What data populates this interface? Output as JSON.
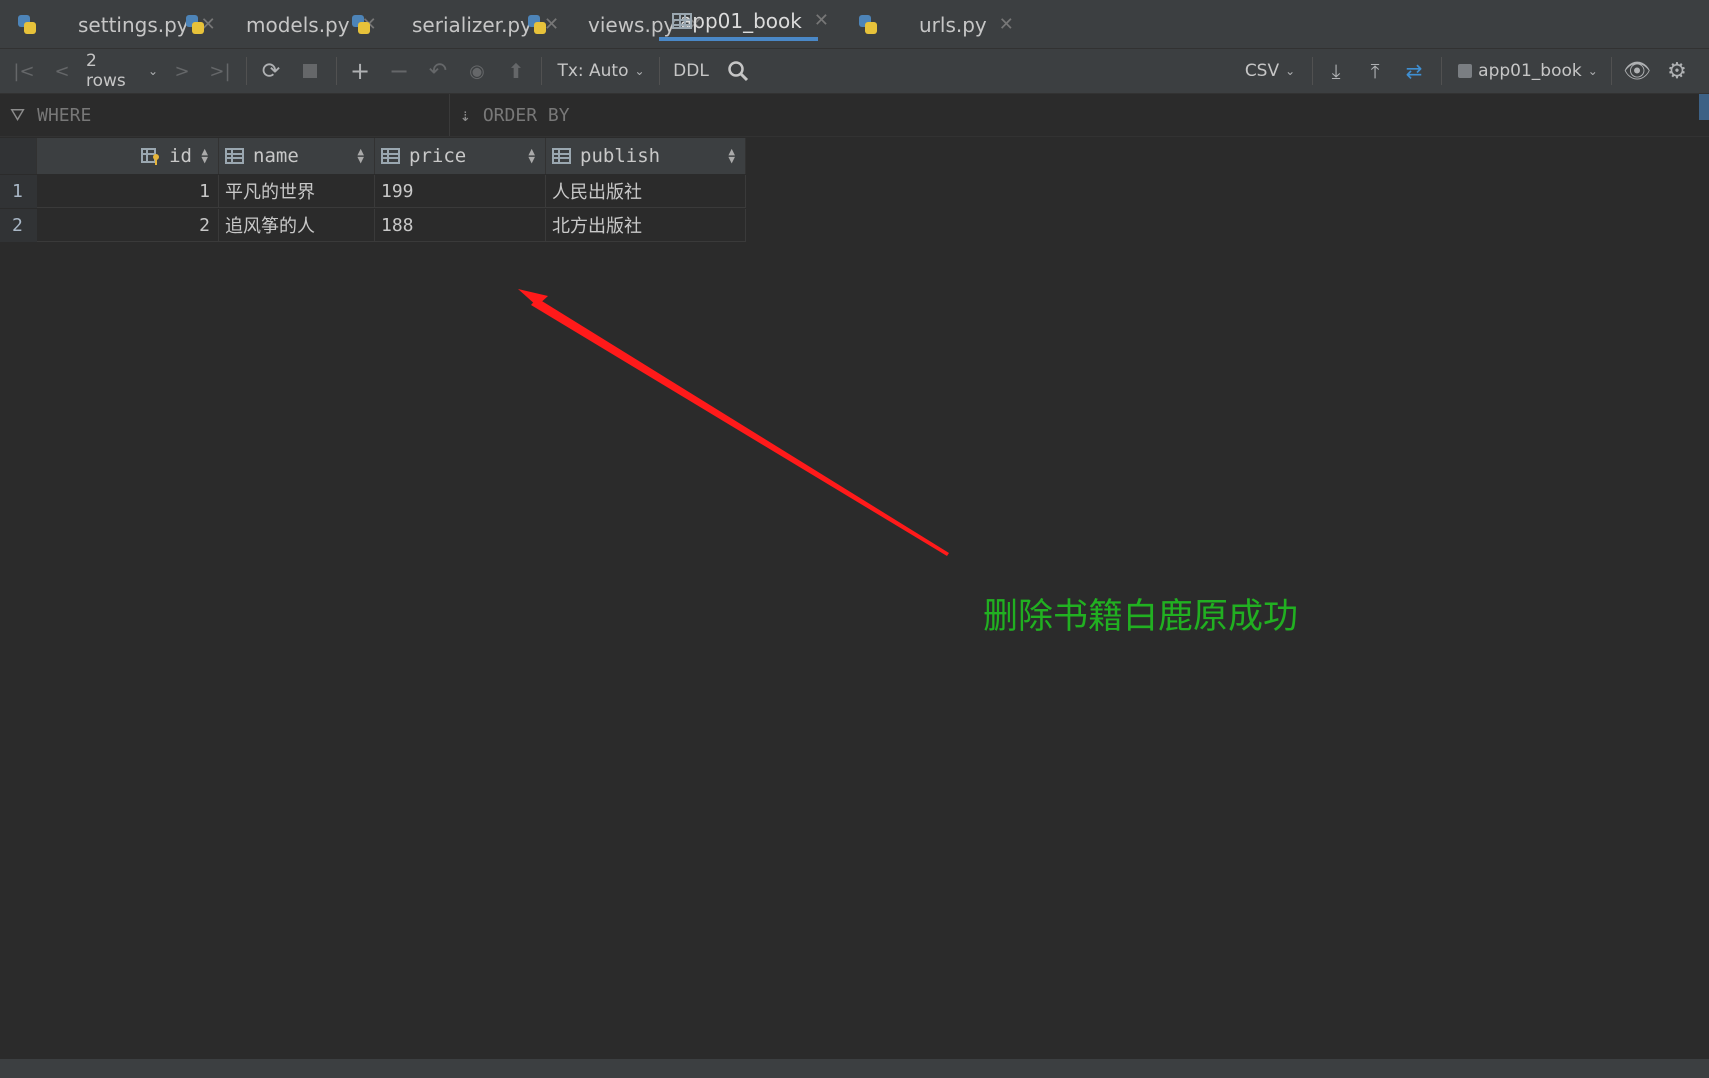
{
  "tabs": [
    {
      "label": "settings.py",
      "icon": "python-file-icon"
    },
    {
      "label": "models.py",
      "icon": "python-file-icon"
    },
    {
      "label": "serializer.py",
      "icon": "python-file-icon"
    },
    {
      "label": "views.py",
      "icon": "python-file-icon"
    },
    {
      "label": "app01_book",
      "icon": "table-icon",
      "active": true
    },
    {
      "label": "urls.py",
      "icon": "python-file-icon"
    }
  ],
  "toolbar": {
    "rows_label": "2 rows",
    "tx_label": "Tx: Auto",
    "ddl_label": "DDL",
    "export_format": "CSV",
    "table_selector": "app01_book"
  },
  "filter": {
    "where_label": "WHERE",
    "order_by_label": "ORDER BY"
  },
  "table": {
    "columns": [
      "id",
      "name",
      "price",
      "publish"
    ],
    "row_numbers": [
      "1",
      "2"
    ],
    "rows": [
      [
        "1",
        "平凡的世界",
        "199",
        "人民出版社"
      ],
      [
        "2",
        "追风筝的人",
        "188",
        "北方出版社"
      ]
    ]
  },
  "annotation": {
    "text": "删除书籍白鹿原成功",
    "text_color": "#21b021",
    "arrow_color": "#ff1a1a"
  },
  "colors": {
    "background": "#2b2b2b",
    "chrome": "#3c3f41",
    "active_tab_accent": "#4a88c7"
  }
}
